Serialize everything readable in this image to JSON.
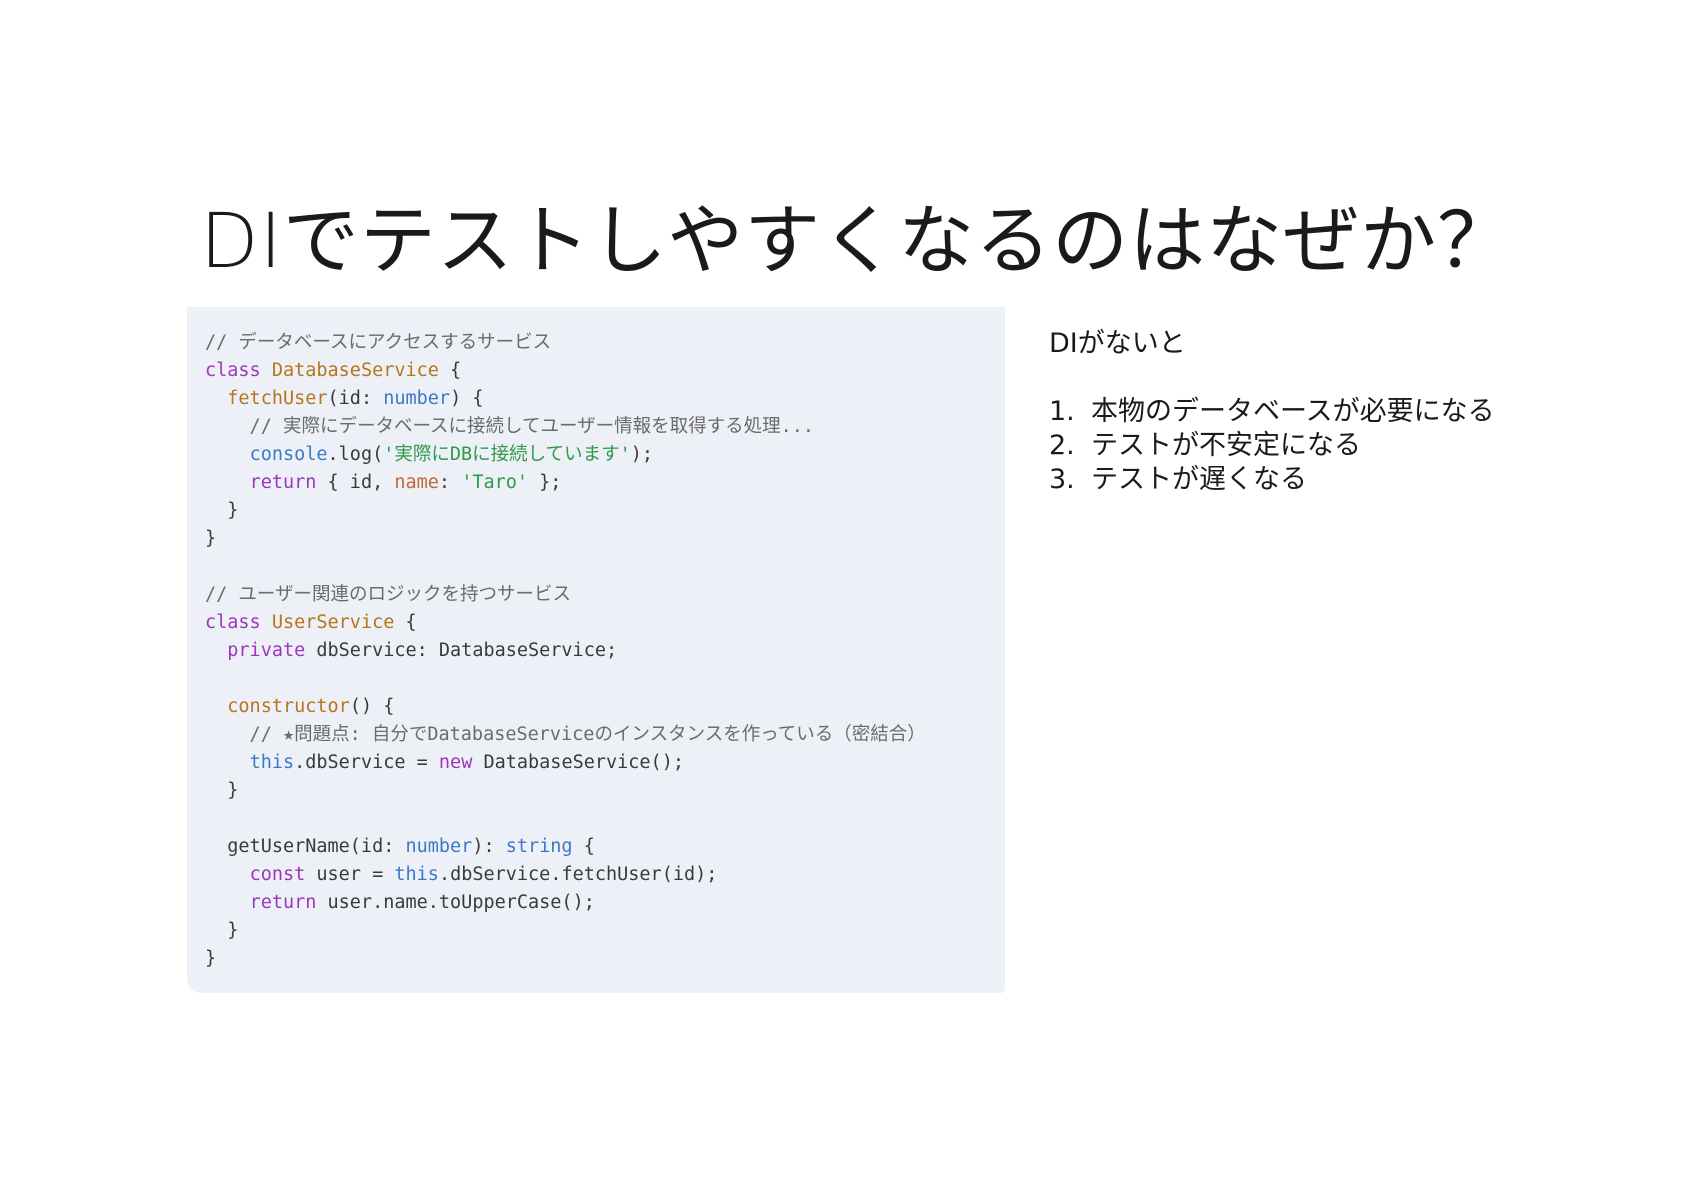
{
  "slide": {
    "title": "DIでテストしやすくなるのはなぜか？"
  },
  "code": {
    "lines": [
      [
        {
          "t": "// データベースにアクセスするサービス",
          "c": "comment"
        }
      ],
      [
        {
          "t": "class",
          "c": "keyword"
        },
        {
          "t": " "
        },
        {
          "t": "DatabaseService",
          "c": "class"
        },
        {
          "t": " {"
        }
      ],
      [
        {
          "t": "  "
        },
        {
          "t": "fetchUser",
          "c": "func"
        },
        {
          "t": "(id: "
        },
        {
          "t": "number",
          "c": "type"
        },
        {
          "t": ") {"
        }
      ],
      [
        {
          "t": "    // 実際にデータベースに接続してユーザー情報を取得する処理...",
          "c": "comment"
        }
      ],
      [
        {
          "t": "    "
        },
        {
          "t": "console",
          "c": "blue"
        },
        {
          "t": ".log("
        },
        {
          "t": "'実際にDBに接続しています'",
          "c": "string"
        },
        {
          "t": ");"
        }
      ],
      [
        {
          "t": "    "
        },
        {
          "t": "return",
          "c": "keyword"
        },
        {
          "t": " { id, "
        },
        {
          "t": "name",
          "c": "prop"
        },
        {
          "t": ": "
        },
        {
          "t": "'Taro'",
          "c": "string"
        },
        {
          "t": " };"
        }
      ],
      [
        {
          "t": "  }"
        }
      ],
      [
        {
          "t": "}"
        }
      ],
      [],
      [
        {
          "t": "// ユーザー関連のロジックを持つサービス",
          "c": "comment"
        }
      ],
      [
        {
          "t": "class",
          "c": "keyword"
        },
        {
          "t": " "
        },
        {
          "t": "UserService",
          "c": "class"
        },
        {
          "t": " {"
        }
      ],
      [
        {
          "t": "  "
        },
        {
          "t": "private",
          "c": "keyword"
        },
        {
          "t": " dbService: DatabaseService;"
        }
      ],
      [],
      [
        {
          "t": "  "
        },
        {
          "t": "constructor",
          "c": "func"
        },
        {
          "t": "() {"
        }
      ],
      [
        {
          "t": "    // ★問題点: 自分でDatabaseServiceのインスタンスを作っている（密結合）",
          "c": "comment"
        }
      ],
      [
        {
          "t": "    "
        },
        {
          "t": "this",
          "c": "blue"
        },
        {
          "t": ".dbService = "
        },
        {
          "t": "new",
          "c": "keyword"
        },
        {
          "t": " DatabaseService();"
        }
      ],
      [
        {
          "t": "  }"
        }
      ],
      [],
      [
        {
          "t": "  getUserName(id: "
        },
        {
          "t": "number",
          "c": "type"
        },
        {
          "t": "): "
        },
        {
          "t": "string",
          "c": "type"
        },
        {
          "t": " {"
        }
      ],
      [
        {
          "t": "    "
        },
        {
          "t": "const",
          "c": "keyword"
        },
        {
          "t": " user = "
        },
        {
          "t": "this",
          "c": "blue"
        },
        {
          "t": ".dbService.fetchUser(id);"
        }
      ],
      [
        {
          "t": "    "
        },
        {
          "t": "return",
          "c": "keyword"
        },
        {
          "t": " user.name.toUpperCase();"
        }
      ],
      [
        {
          "t": "  }"
        }
      ],
      [
        {
          "t": "}"
        }
      ]
    ]
  },
  "notes": {
    "intro": "DIがないと",
    "items": [
      {
        "num": "1.",
        "text": "本物のデータベースが必要になる"
      },
      {
        "num": "2.",
        "text": "テストが不安定になる"
      },
      {
        "num": "3.",
        "text": "テストが遅くなる"
      }
    ]
  },
  "colors": {
    "code_background": "#edf1f7",
    "comment": "#6b6b6b",
    "keyword": "#9b38b8",
    "class_name": "#b5761b",
    "type": "#3b79c8",
    "string": "#2e9a4a",
    "property": "#c0683a"
  }
}
